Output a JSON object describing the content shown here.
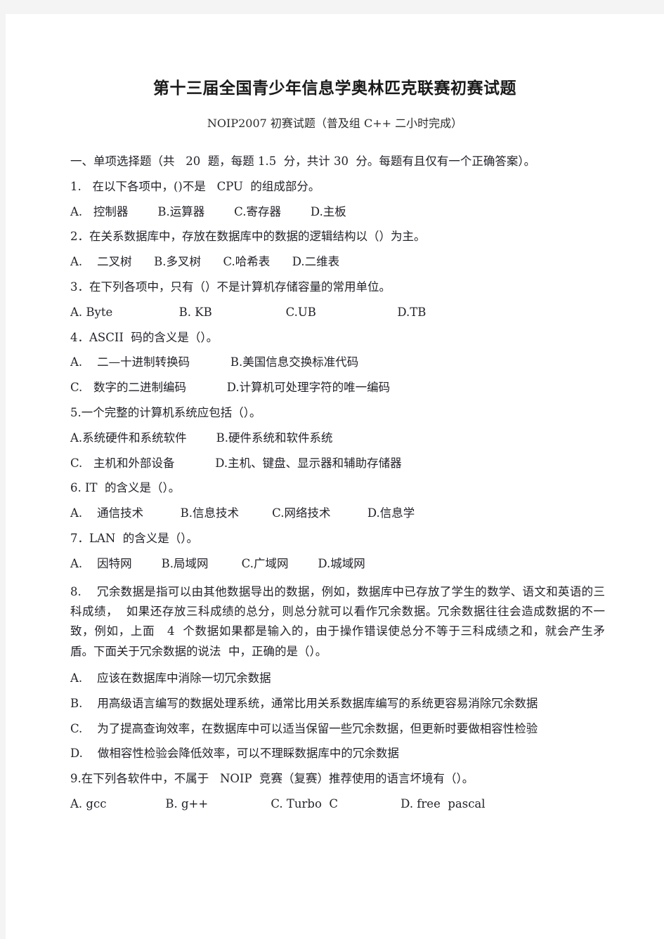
{
  "document": {
    "title": "第十三届全国青少年信息学奥林匹克联赛初赛试题",
    "subtitle": "NOIP2007  初赛试题（普及组   C++   二小时完成）",
    "section_heading": "一、单项选择题（共   20  题，每题 1.5  分，共计 30  分。每题有且仅有一个正确答案）。",
    "lines": [
      "1.   在以下各项中，()不是   CPU  的组成部分。",
      "A.   控制器        B.运算器        C.寄存器        D.主板",
      "2．在关系数据库中，存放在数据库中的数据的逻辑结构以（）为主。",
      "A.    二叉树      B.多叉树      C.哈希表      D.二维表",
      "3．在下列各项中，只有（）不是计算机存储容量的常用单位。",
      "A. Byte                  B. KB                    C.UB                      D.TB",
      "4．ASCII  码的含义是（）。",
      "A.    二—十进制转换码           B.美国信息交换标准代码",
      "C.   数字的二进制编码           D.计算机可处理字符的唯一编码",
      "5.一个完整的计算机系统应包括（）。",
      "A.系统硬件和系统软件        B.硬件系统和软件系统",
      "C.   主机和外部设备           D.主机、键盘、显示器和辅助存储器",
      "6. IT  的含义是（）。",
      "A.    通信技术          B.信息技术         C.网络技术          D.信息学",
      "7．LAN  的含义是（）。",
      "A.    因特网        B.局域网         C.广域网        D.城域网",
      "8.    冗余数据是指可以由其他数据导出的数据，例如，数据库中已存放了学生的数学、语文和英语的三科成绩，  如果还存放三科成绩的总分，则总分就可以看作冗余数据。冗余数据往往会造成数据的不一致，例如，上面   4  个数据如果都是输入的，由于操作错误使总分不等于三科成绩之和，就会产生矛盾。下面关于冗余数据的说法  中，正确的是（）。",
      "A.    应该在数据库中消除一切冗余数据",
      "B.    用高级语言编写的数据处理系统，通常比用关系数据库编写的系统更容易消除冗余数据",
      "C.    为了提高查询效率，在数据库中可以适当保留一些冗余数据，但更新时要做相容性检验",
      "D.    做相容性检验会降低效率，可以不理睬数据库中的冗余数据",
      "9.在下列各软件中，不属于   NOIP  竞赛（复赛）推荐使用的语言坏境有（）。",
      "A. gcc                B. g++                 C. Turbo  C                 D. free  pascal"
    ]
  },
  "style": {
    "text_color": "#23232b",
    "page_background": "#ffffff",
    "margin_background": "#f4f4f4"
  }
}
